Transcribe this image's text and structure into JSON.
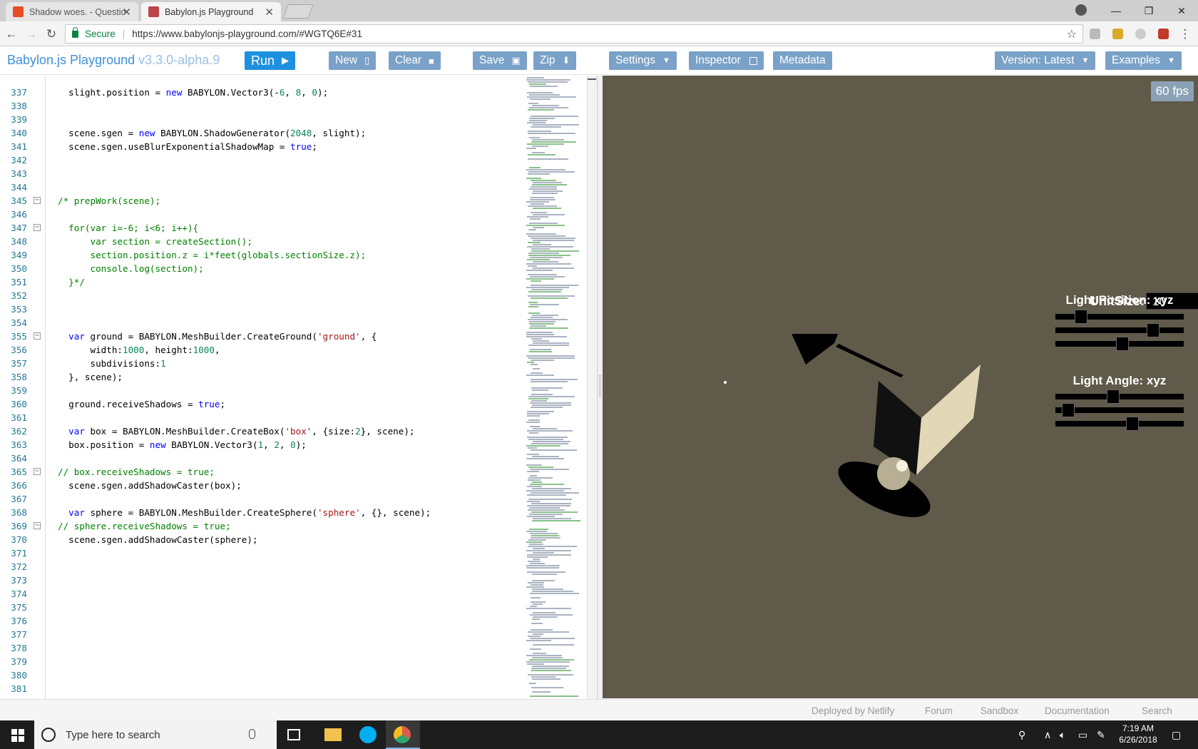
{
  "browser": {
    "tabs": [
      {
        "title": "Shadow woes. - Questio",
        "active": false
      },
      {
        "title": "Babylon.js Playground",
        "active": true
      }
    ],
    "secure_label": "Secure",
    "url": "https://www.babylonjs-playground.com/#WGTQ6E#31"
  },
  "header": {
    "brand": "Babylon.js Playground",
    "version": "v3.3.0-alpha.9",
    "run": "Run",
    "new": "New",
    "clear": "Clear",
    "save": "Save",
    "zip": "Zip",
    "settings": "Settings",
    "inspector": "Inspector",
    "metadata": "Metadata",
    "version_select": "Version: Latest",
    "examples": "Examples"
  },
  "editor": {
    "lines": [
      {
        "n": "337",
        "fold": false,
        "html": "  slight.position = <span class=\"kw\">new</span> BABYLON.Vector3(-<span class=\"nm\">6</span>, <span class=\"nm\">8</span>, <span class=\"nm\">0</span>);"
      },
      {
        "n": "338",
        "fold": false,
        "html": ""
      },
      {
        "n": "339",
        "fold": false,
        "html": ""
      },
      {
        "n": "340",
        "fold": false,
        "html": "  scene.sgen = <span class=\"kw\">new</span> BABYLON.ShadowGenerator(<span class=\"nm\">2048</span>, slight);"
      },
      {
        "n": "341",
        "fold": false,
        "html": "  scene.sgen.useBlurExponentialShadowMap = <span class=\"kw\">true</span>;"
      },
      {
        "n": "342",
        "fold": false,
        "html": ""
      },
      {
        "n": "343",
        "fold": false,
        "html": ""
      },
      {
        "n": "344",
        "fold": false,
        "html": ""
      },
      {
        "n": "345",
        "fold": true,
        "html": "<span class=\"cm\">/* prepWork(scene);</span>"
      },
      {
        "n": "346",
        "fold": false,
        "html": ""
      },
      {
        "n": "347",
        "fold": true,
        "html": "<span class=\"cm\">  for(var i=-6; i<6; i++){</span>"
      },
      {
        "n": "348",
        "fold": false,
        "html": "<span class=\"cm\">      var section = createSection();</span>"
      },
      {
        "n": "349",
        "fold": false,
        "html": "<span class=\"cm\">      section.position.z = i*feet(globals.sectionSize.z);</span>"
      },
      {
        "n": "350",
        "fold": false,
        "html": "<span class=\"cm\">      console.log(section);</span>"
      },
      {
        "n": "351",
        "fold": false,
        "html": "<span class=\"cm\">  }*/</span>"
      },
      {
        "n": "352",
        "fold": false,
        "html": ""
      },
      {
        "n": "353",
        "fold": false,
        "html": ""
      },
      {
        "n": "354",
        "fold": false,
        "html": ""
      },
      {
        "n": "355",
        "fold": true,
        "html": "  <span class=\"kw\">var</span> ground = BABYLON.MeshBuilder.CreateGround(<span class=\"st\">'ground'</span>, {"
      },
      {
        "n": "356",
        "fold": false,
        "html": "      width:<span class=\"nm\">1000</span>, height:<span class=\"nm\">1000</span>,"
      },
      {
        "n": "357",
        "fold": false,
        "html": "      subdivisions:<span class=\"nm\">1</span>"
      },
      {
        "n": "358",
        "fold": false,
        "html": "  }, scene);"
      },
      {
        "n": "359",
        "fold": false,
        "html": ""
      },
      {
        "n": "360",
        "fold": false,
        "html": "  ground.receiveShadows = <span class=\"kw\">true</span>;"
      },
      {
        "n": "361",
        "fold": false,
        "html": ""
      },
      {
        "n": "362",
        "fold": false,
        "html": "  <span class=\"kw\">var</span> box = BABYLON.MeshBuilder.CreateBox(<span class=\"st\">'box'</span>, {size:<span class=\"nm\">2</span>}, scene);"
      },
      {
        "n": "363",
        "fold": false,
        "html": "  box.position = <span class=\"kw\">new</span> BABYLON.Vector3(<span class=\"nm\">1</span>, <span class=\"nm\">2</span>, <span class=\"nm\">0</span>);"
      },
      {
        "n": "364",
        "fold": false,
        "html": ""
      },
      {
        "n": "365",
        "fold": true,
        "html": "<span class=\"cm\">// box.receiveShadows = true;</span>"
      },
      {
        "n": "366",
        "fold": false,
        "html": "  scene.sgen.addShadowCaster(box);"
      },
      {
        "n": "367",
        "fold": false,
        "html": ""
      },
      {
        "n": "368",
        "fold": false,
        "html": "  <span class=\"kw\">var</span> sphere = BABYLON.MeshBuilder.CreateSphere(<span class=\"st\">'sphere'</span>, {}, scene);"
      },
      {
        "n": "369",
        "fold": true,
        "html": "<span class=\"cm\">// sphere.receiveShadows = true;</span>"
      },
      {
        "n": "370",
        "fold": false,
        "html": "  scene.sgen.addShadowCaster(sphere);"
      },
      {
        "n": "371",
        "fold": false,
        "html": ""
      },
      {
        "n": "372",
        "fold": false,
        "html": ""
      },
      {
        "n": "373",
        "fold": false,
        "html": ""
      },
      {
        "n": "374",
        "fold": false,
        "html": ""
      },
      {
        "n": "375",
        "fold": false,
        "html": ""
      },
      {
        "n": "376",
        "fold": false,
        "html": ""
      },
      {
        "n": "377",
        "fold": false,
        "html": ""
      },
      {
        "n": "378",
        "fold": false,
        "html": ""
      },
      {
        "n": "379",
        "fold": false,
        "html": ""
      },
      {
        "n": "380",
        "fold": false,
        "html": ""
      },
      {
        "n": "381",
        "fold": false,
        "html": ""
      }
    ]
  },
  "scene": {
    "fps": "60 fps",
    "unitsize_label": "UnitSize:",
    "unitsize_value": "10",
    "light_position_label": "Light Position: xyz",
    "light_angle_label": "Light Angle: xyz",
    "light_position_sliders": [
      0.2,
      0.76,
      0.52
    ],
    "light_angle_sliders": [
      0.45,
      0.1,
      0.6
    ],
    "background_color": "#5f5a4a"
  },
  "footer": {
    "links": [
      "Deployed by Netlify",
      "Forum",
      "Sandbox",
      "Documentation",
      "Search"
    ]
  },
  "taskbar": {
    "search_placeholder": "Type here to search",
    "time": "7:19 AM",
    "date": "6/26/2018"
  }
}
